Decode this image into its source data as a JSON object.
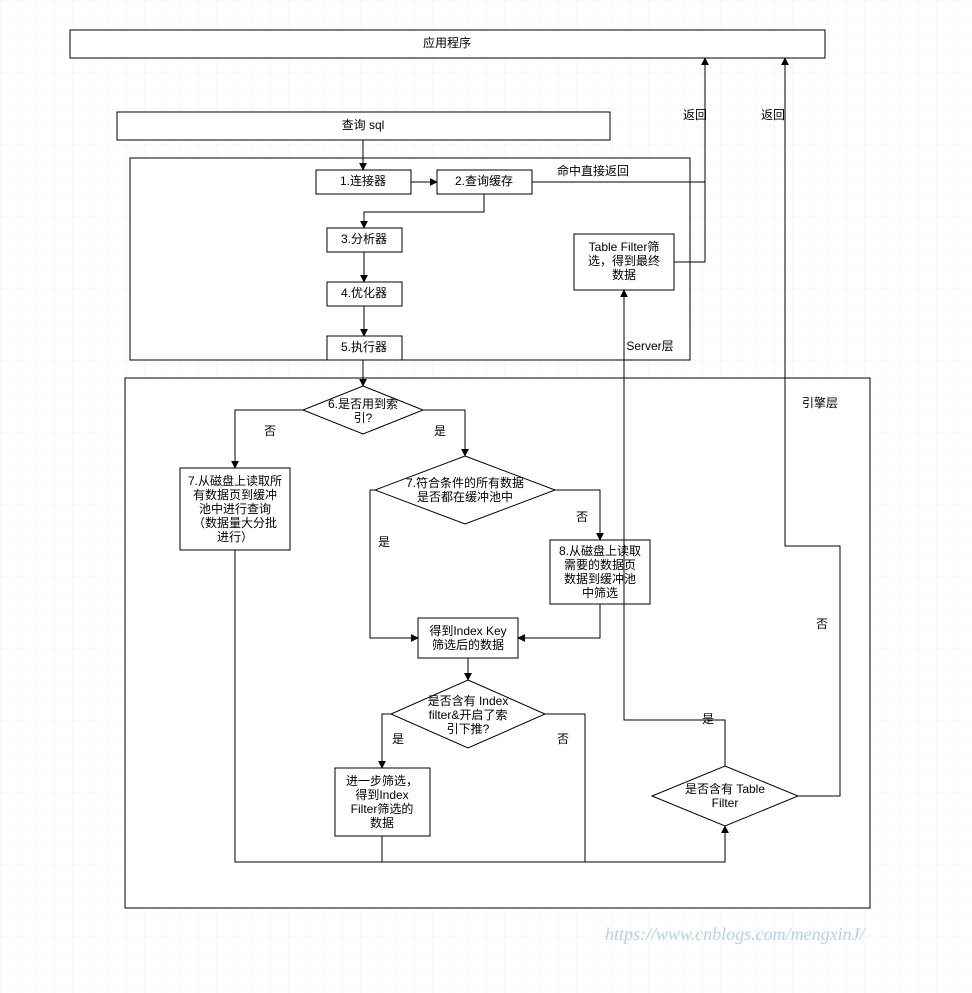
{
  "app": {
    "title": "应用程序"
  },
  "query": {
    "title": "查询 sql"
  },
  "server": {
    "label": "Server层",
    "steps": {
      "s1": "1.连接器",
      "s2": "2.查询缓存",
      "s2_hit": "命中直接返回",
      "s3": "3.分析器",
      "s4": "4.优化器",
      "s5": "5.执行器"
    },
    "table_filter_box_l1": "Table Filter筛",
    "table_filter_box_l2": "选，得到最终",
    "table_filter_box_l3": "数据"
  },
  "engine": {
    "label": "引擎层",
    "d6": {
      "l1": "6.是否用到索",
      "l2": "引?"
    },
    "b7a": {
      "l1": "7.从磁盘上读取所",
      "l2": "有数据页到缓冲",
      "l3": "池中进行查询",
      "l4": "（数据量大分批",
      "l5": "进行）"
    },
    "d7b": {
      "l1": "7.符合条件的所有数据",
      "l2": "是否都在缓冲池中"
    },
    "b8": {
      "l1": "8.从磁盘上读取",
      "l2": "需要的数据页",
      "l3": "数据到缓冲池",
      "l4": "中筛选"
    },
    "bik": {
      "l1": "得到Index Key",
      "l2": "筛选后的数据"
    },
    "dif": {
      "l1": "是否含有 Index",
      "l2": "filter&开启了索",
      "l3": "引下推?"
    },
    "bif": {
      "l1": "进一步筛选，",
      "l2": "得到Index",
      "l3": "Filter筛选的",
      "l4": "数据"
    },
    "dtf": {
      "l1": "是否含有 Table",
      "l2": "Filter"
    }
  },
  "edge": {
    "yes": "是",
    "no": "否",
    "ret": "返回"
  },
  "watermark": "https://www.cnblogs.com/mengxinJ/"
}
